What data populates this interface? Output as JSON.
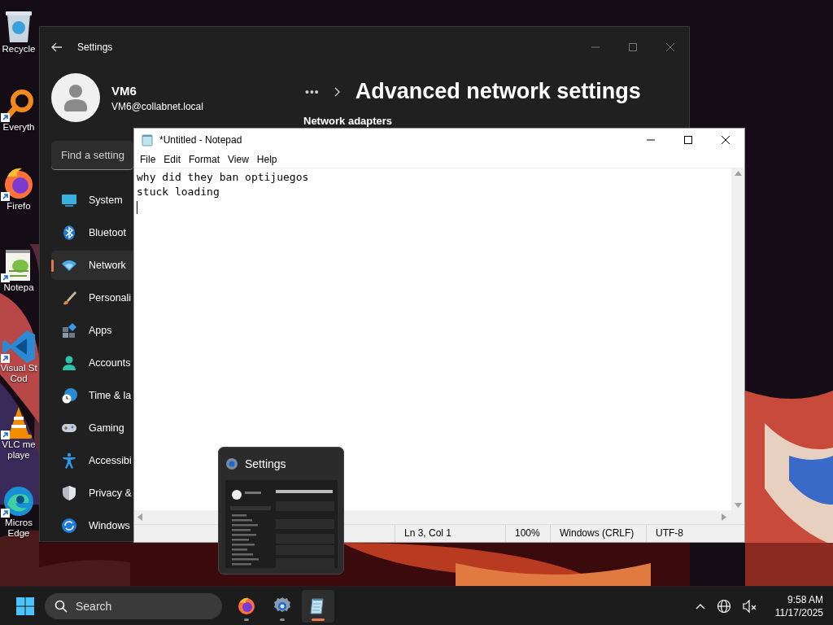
{
  "desktop_icons": [
    {
      "kind": "recycle",
      "lines": [
        "Recycle"
      ],
      "shortcut": false
    },
    {
      "kind": "search",
      "lines": [
        "Everyth"
      ],
      "shortcut": true
    },
    {
      "kind": "firefox",
      "lines": [
        "Firefo"
      ],
      "shortcut": true
    },
    {
      "kind": "notepadpp",
      "lines": [
        "Notepa"
      ],
      "shortcut": true
    },
    {
      "kind": "vscode",
      "lines": [
        "Visual St",
        "Cod"
      ],
      "shortcut": true
    },
    {
      "kind": "vlc",
      "lines": [
        "VLC me",
        "playe"
      ],
      "shortcut": true
    },
    {
      "kind": "edge",
      "lines": [
        "Micros",
        "Edge"
      ],
      "shortcut": true
    }
  ],
  "settings_window": {
    "title": "Settings",
    "user": {
      "name": "VM6",
      "email": "VM6@collabnet.local"
    },
    "search": {
      "placeholder": "Find a setting"
    },
    "nav": [
      {
        "kind": "system",
        "label": "System",
        "selected": false
      },
      {
        "kind": "bluetooth",
        "label": "Bluetoot",
        "selected": false
      },
      {
        "kind": "network",
        "label": "Network",
        "selected": true
      },
      {
        "kind": "personalization",
        "label": "Personali",
        "selected": false
      },
      {
        "kind": "apps",
        "label": "Apps",
        "selected": false
      },
      {
        "kind": "accounts",
        "label": "Accounts",
        "selected": false
      },
      {
        "kind": "time",
        "label": "Time & la",
        "selected": false
      },
      {
        "kind": "gaming",
        "label": "Gaming",
        "selected": false
      },
      {
        "kind": "accessibility",
        "label": "Accessibi",
        "selected": false
      },
      {
        "kind": "privacy",
        "label": "Privacy &",
        "selected": false
      },
      {
        "kind": "update",
        "label": "Windows",
        "selected": false
      }
    ],
    "breadcrumb_overflow": "•••",
    "page_title": "Advanced network settings",
    "section_heading": "Network adapters"
  },
  "notepad": {
    "title": "*Untitled - Notepad",
    "menu": [
      "File",
      "Edit",
      "Format",
      "View",
      "Help"
    ],
    "lines": [
      "why did they ban optijuegos",
      "stuck loading"
    ],
    "status": [
      "Ln 3, Col 1",
      "100%",
      "Windows (CRLF)",
      "UTF-8"
    ]
  },
  "thumbnail": {
    "title": "Settings"
  },
  "taskbar": {
    "search": {
      "placeholder": "Search"
    },
    "apps": [
      {
        "kind": "firefox",
        "selected": false
      },
      {
        "kind": "settings",
        "selected": false
      },
      {
        "kind": "notepad",
        "selected": true
      }
    ],
    "time": "9:58 AM",
    "date": "11/17/2025"
  }
}
